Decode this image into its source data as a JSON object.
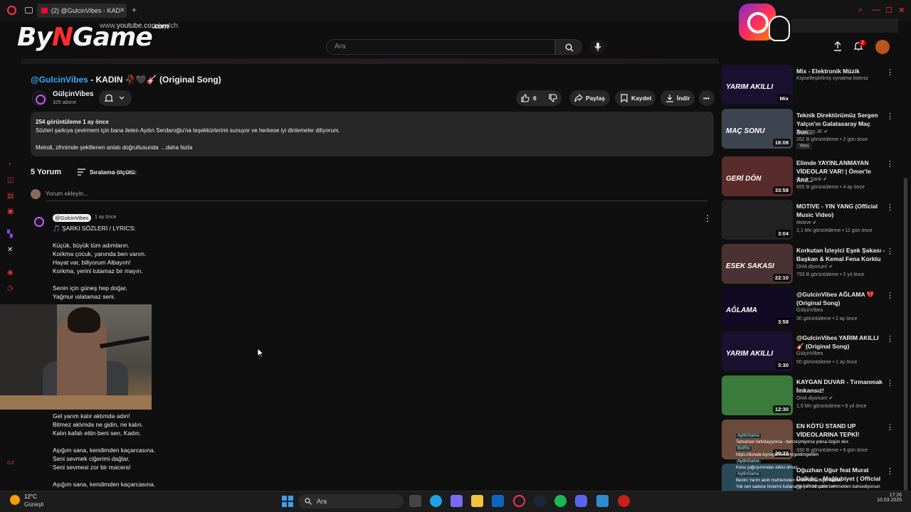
{
  "browser": {
    "tab_title": "(2) @GulcinVibes - KAD",
    "url_prefix": "www.",
    "url_domain": "youtube.com",
    "url_path": "/watch"
  },
  "watermark": {
    "part1": "By",
    "slash": "N",
    "part2": "Game",
    "sub": ".com"
  },
  "header": {
    "search_placeholder": "Ara",
    "notification_count": "2"
  },
  "video": {
    "title_handle": "@GulcinVibes",
    "title_rest": " - KADIN 🥀🖤🎸 (Original Song)",
    "channel_name": "GülçinVibes",
    "subscribers": "325 abone",
    "like_count": "6",
    "share_label": "Paylaş",
    "save_label": "Kaydet",
    "download_label": "İndir"
  },
  "description": {
    "stats": "254 görüntüleme  1 ay önce",
    "line1": "Sözleri şarkıya çevirmem için bana ileten Aydın Serdaroğlu'na teşekkürlerimi sunuyor ve herkese iyi dinlemeler diliyorum.",
    "line2": "Melodi, zihnimde şekillenen anlatı doğrultusunda",
    "more": "...daha fazla"
  },
  "comments": {
    "count_label": "5 Yorum",
    "sort_label": "Sıralama ölçütü:",
    "add_placeholder": "Yorum ekleyin...",
    "pinned": {
      "author": "@GulcinVibes",
      "time": "1 ay önce",
      "lyrics": [
        "🎵 ŞARKI SÖZLERİ / LYRICS:",
        "Küçük, büyük tüm adımların.",
        "Korkma çocuk, yanında ben varım.",
        "Hayat var, biliyorum Albayım!",
        "Korkma, yerini tutamaz bir mayın.",
        "Senin için güneş hep doğar,",
        "Yağmur ıslatamaz seni.",
        "Gel yarım kalır aklımda adın!",
        "Bitmez aklımda ne gidin, ne kalın.",
        "Kalın kafalı ettin beni sen, Kadın.",
        "Aşığım sana, kendimden kaçarcasına.",
        "Seni sevmek ciğerimi dağlar,",
        "Seni sevmesi zor bir macera!",
        "Aşığım sana, kendimden kaçarcasına."
      ]
    }
  },
  "sidebar": {
    "items": [
      {
        "title": "Mix - Elektronik Müzik",
        "channel": "Kişiselleştirilmiş oynatma listeniz",
        "meta": "",
        "duration": "Mix",
        "thumb_color": "#1a1030",
        "thumb_text": "YARIM AKILLI",
        "new": ""
      },
      {
        "title": "Teknik Direktörümüz Sergen Yalçın'ın Galatasaray Maç Son...",
        "channel": "Beşiktaş JK ✔",
        "meta": "262 B görüntüleme • 2 gün önce",
        "duration": "18:08",
        "thumb_color": "#3d4450",
        "thumb_text": "MAÇ SONU",
        "new": "Yeni"
      },
      {
        "title": "Elimde YAYINLANMAYAN VİDEOLAR VAR! | Ömer'le Anıl...",
        "channel": "Ömer Şanlı ✔",
        "meta": "655 B görüntüleme • 4 ay önce",
        "duration": "33:58",
        "thumb_color": "#5a2b2b",
        "thumb_text": "GERİ DÖN",
        "new": ""
      },
      {
        "title": "MOTIVE - YIN YANG (Official Music Video)",
        "channel": "Motive ✔",
        "meta": "2,1 Mn görüntüleme • 11 gün önce",
        "duration": "3:04",
        "thumb_color": "#222222",
        "thumb_text": "",
        "new": ""
      },
      {
        "title": "Korkutan İzleyici Eşek Şakası - Başkan & Kemal Fena Korktu",
        "channel": "OHA diyorum! ✔",
        "meta": "793 B görüntüleme • 2 yıl önce",
        "duration": "22:10",
        "thumb_color": "#4a3232",
        "thumb_text": "ESEK SAKASI",
        "new": ""
      },
      {
        "title": "@GulcinVibes AĞLAMA 💔 (Original Song)",
        "channel": "GülçinVibes",
        "meta": "30 görüntüleme • 2 ay önce",
        "duration": "3:58",
        "thumb_color": "#120a24",
        "thumb_text": "AĞLAMA",
        "new": ""
      },
      {
        "title": "@GulcinVibes YARIM AKILLI 🎸 (Original Song)",
        "channel": "GülçinVibes",
        "meta": "50 görüntüleme • 1 ay önce",
        "duration": "3:30",
        "thumb_color": "#1a1030",
        "thumb_text": "YARIM AKILLI",
        "new": ""
      },
      {
        "title": "KAYGAN DUVAR - Tırmanmak İmkansız!",
        "channel": "OHA diyorum! ✔",
        "meta": "1,5 Mn görüntüleme • 6 yıl önce",
        "duration": "12:30",
        "thumb_color": "#3a7a3a",
        "thumb_text": "",
        "new": ""
      },
      {
        "title": "EN KÖTÜ STAND UP VİDEOLARINA TEPKİ!",
        "channel": "",
        "meta": "330 B görüntüleme • 6 gün önce",
        "duration": "29:22",
        "thumb_color": "#6a4a3a",
        "thumb_text": "",
        "new": ""
      },
      {
        "title": "Oğuzhan Uğur feat Murat Dalkılıç - Mağlubiyet ( Official ...",
        "channel": "Poll Production ✔",
        "meta": "",
        "duration": "",
        "thumb_color": "#2a4a5a",
        "thumb_text": "",
        "new": ""
      }
    ]
  },
  "chat": {
    "lines": [
      {
        "name": "AydinSama",
        "text": ""
      },
      {
        "name": "",
        "text": "Tamamen farklılaşıyorsa - benzeşmiyorsa yoksa özgün olur."
      },
      {
        "name": "BotRix",
        "text": ""
      },
      {
        "name": "",
        "text": "https://donate.bynogame.com/geldimgeldim"
      },
      {
        "name": "AydinSama",
        "text": ""
      },
      {
        "name": "",
        "text": "Konu çağrışımından etkisi olmaz"
      },
      {
        "name": "AydinSama",
        "text": ""
      },
      {
        "name": "",
        "text": "Benim Yarım akıllı muhtemelen senin kast ettiğin tarzda"
      },
      {
        "name": "",
        "text": "Yok sen sadece hislerini kullanarak yeni bir şarkı ürettmeklen bahsediyorsun"
      }
    ]
  },
  "taskbar": {
    "temp": "12°C",
    "condition": "Güneşli",
    "search": "Ara",
    "time": "17:26",
    "date": "10.03.2025"
  },
  "colors": {
    "accent": "#3ea6ff",
    "brand_red": "#ff0033",
    "bg": "#0f0f0f",
    "panel": "#272727"
  }
}
